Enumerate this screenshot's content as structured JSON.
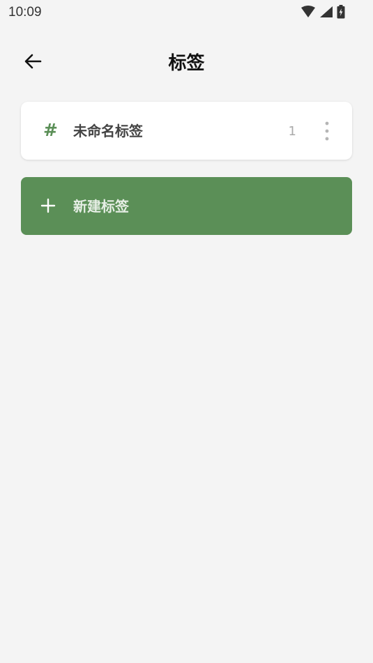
{
  "status_bar": {
    "time": "10:09",
    "icons": [
      "wifi-icon",
      "signal-icon",
      "battery-icon"
    ]
  },
  "header": {
    "back_icon": "arrow-left-icon",
    "title": "标签"
  },
  "tags": [
    {
      "icon": "hash-icon",
      "symbol": "#",
      "name": "未命名标签",
      "count": "1",
      "more_icon": "more-vertical-icon"
    }
  ],
  "new_tag": {
    "icon": "plus-icon",
    "label": "新建标签"
  },
  "colors": {
    "background": "#f4f4f4",
    "card": "#ffffff",
    "accent": "#5b8f57",
    "title": "#111111",
    "muted": "#aaaaaa"
  }
}
